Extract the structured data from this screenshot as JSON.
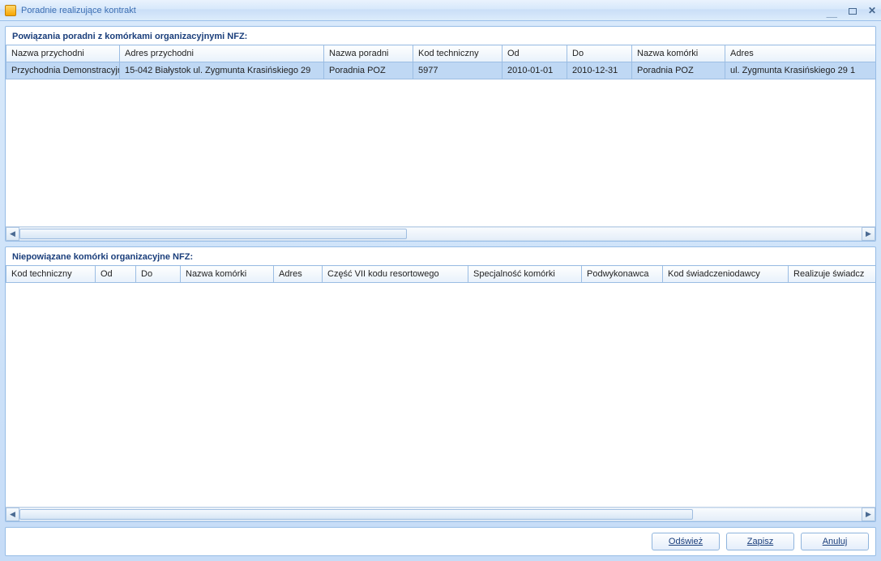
{
  "window": {
    "title": "Poradnie realizujące kontrakt"
  },
  "topPanel": {
    "title": "Powiązania poradni z komórkami organizacyjnymi NFZ:",
    "columns": [
      "Nazwa przychodni",
      "Adres przychodni",
      "Nazwa poradni",
      "Kod techniczny",
      "Od",
      "Do",
      "Nazwa komórki",
      "Adres"
    ],
    "rows": [
      {
        "c0": "Przychodnia Demonstracyjna",
        "c1": "15-042 Białystok ul. Zygmunta  Krasińskiego 29",
        "c2": "Poradnia POZ",
        "c3": "5977",
        "c4": "2010-01-01",
        "c5": "2010-12-31",
        "c6": "Poradnia POZ",
        "c7": "ul. Zygmunta  Krasińskiego 29 1"
      }
    ]
  },
  "midPanel": {
    "title": "Niepowiązane komórki organizacyjne NFZ:",
    "columns": [
      "Kod techniczny",
      "Od",
      "Do",
      "Nazwa komórki",
      "Adres",
      "Część VII kodu resortowego",
      "Specjalność komórki",
      "Podwykonawca",
      "Kod świadczeniodawcy",
      "Realizuje świadcz"
    ]
  },
  "buttons": {
    "refresh": "Odśwież",
    "save": "Zapisz",
    "cancel": "Anuluj"
  }
}
